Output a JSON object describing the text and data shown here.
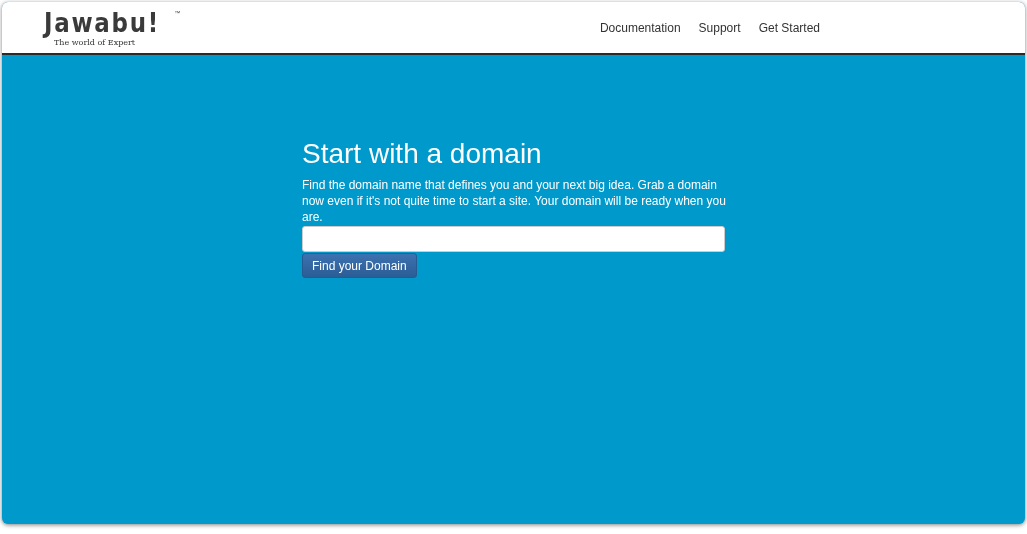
{
  "logo": {
    "name": "Jawabu!",
    "trademark": "™",
    "tagline": "The world of Expert"
  },
  "nav": [
    {
      "label": "Documentation"
    },
    {
      "label": "Support"
    },
    {
      "label": "Get Started"
    }
  ],
  "hero": {
    "title": "Start with a domain",
    "text": "Find the domain name that defines you and your next big idea. Grab a domain now even if it's not quite time to start a site. Your domain will be ready when you are.",
    "button": "Find your Domain"
  }
}
